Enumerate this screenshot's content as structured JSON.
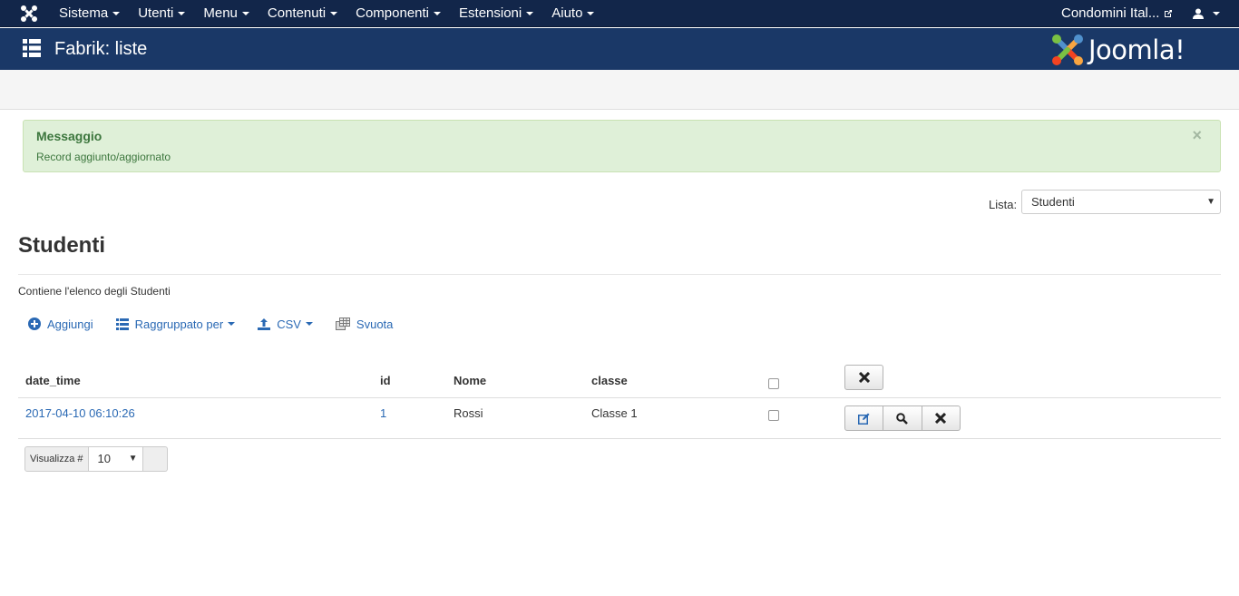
{
  "topbar": {
    "menu": [
      {
        "label": "Sistema"
      },
      {
        "label": "Utenti"
      },
      {
        "label": "Menu"
      },
      {
        "label": "Contenuti"
      },
      {
        "label": "Componenti"
      },
      {
        "label": "Estensioni"
      },
      {
        "label": "Aiuto"
      }
    ],
    "site_label": "Condomini Ital..."
  },
  "header": {
    "title": "Fabrik: liste",
    "brand": "Joomla!"
  },
  "alert": {
    "heading": "Messaggio",
    "body": "Record aggiunto/aggiornato",
    "close": "×"
  },
  "list_selector": {
    "label": "Lista:",
    "value": "Studenti"
  },
  "page": {
    "title": "Studenti",
    "description": "Contiene l'elenco degli Studenti"
  },
  "toolbar": {
    "add_label": "Aggiungi",
    "group_label": "Raggruppato per",
    "csv_label": "CSV",
    "empty_label": "Svuota"
  },
  "table": {
    "headers": [
      "date_time",
      "id",
      "Nome",
      "classe"
    ],
    "rows": [
      {
        "date_time": "2017-04-10 06:10:26",
        "id": "1",
        "nome": "Rossi",
        "classe": "Classe 1"
      }
    ]
  },
  "pagination": {
    "label": "Visualizza #",
    "value": "10"
  },
  "colors": {
    "topbar": "#12264a",
    "header": "#1a3867",
    "link": "#2a69b4",
    "alert_bg": "#dff0d8",
    "alert_text": "#3c763d"
  }
}
